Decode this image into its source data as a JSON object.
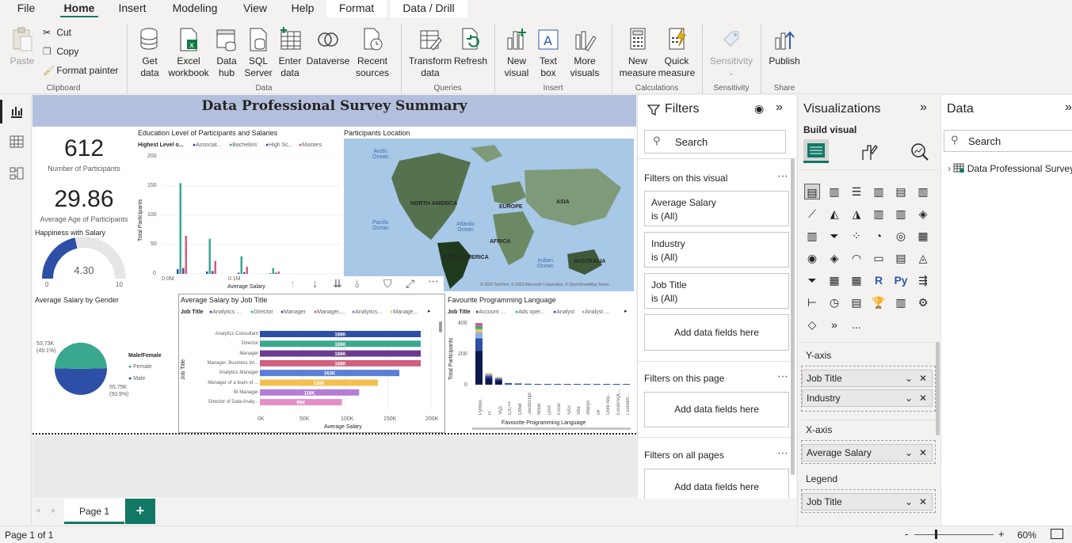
{
  "menu": {
    "tabs": [
      "File",
      "Home",
      "Insert",
      "Modeling",
      "View",
      "Help",
      "Format",
      "Data / Drill"
    ]
  },
  "ribbon": {
    "clipboard": {
      "paste": "Paste",
      "cut": "Cut",
      "copy": "Copy",
      "format_painter": "Format painter",
      "group": "Clipboard"
    },
    "data": {
      "get_data": "Get\ndata",
      "excel": "Excel\nworkbook",
      "datahub": "Data\nhub",
      "sql": "SQL\nServer",
      "enter": "Enter\ndata",
      "dataverse": "Dataverse",
      "recent": "Recent\nsources",
      "group": "Data"
    },
    "queries": {
      "transform": "Transform\ndata",
      "refresh": "Refresh",
      "group": "Queries"
    },
    "insert": {
      "new_visual": "New\nvisual",
      "text_box": "Text\nbox",
      "more": "More\nvisuals",
      "group": "Insert"
    },
    "calculations": {
      "new_measure": "New\nmeasure",
      "quick": "Quick\nmeasure",
      "group": "Calculations"
    },
    "sensitivity": {
      "label": "Sensitivity",
      "group": "Sensitivity"
    },
    "share": {
      "publish": "Publish",
      "group": "Share"
    }
  },
  "report": {
    "title": "Data Professional Survey Summary",
    "kpi1": {
      "value": "612",
      "label": "Number of Participants"
    },
    "kpi2": {
      "value": "29.86",
      "label": "Average Age of Participants"
    },
    "gauge": {
      "title": "Happiness with Salary",
      "value": "4.30",
      "min": "0",
      "max": "10",
      "fraction": 0.43
    },
    "pie": {
      "title": "Average Salary by Gender",
      "legend_title": "Male/Female",
      "female_label": "Female",
      "male_label": "Male",
      "female_value": "53.73K",
      "female_pct": "(49.1%)",
      "male_value": "55.75K",
      "male_pct": "(50.9%)",
      "female_share": 0.491,
      "colors": {
        "female": "#3aa88f",
        "male": "#2e4fa6"
      }
    },
    "edu": {
      "title": "Education Level of Participants and Salaries",
      "legend_title": "Highest Level o...",
      "legend": [
        "Associat...",
        "Bachelors",
        "High Sc...",
        "Masters"
      ],
      "ylabel": "Total Participants",
      "yticks": [
        "200",
        "150",
        "100",
        "50",
        "0"
      ],
      "xticks": [
        "0.0M",
        "0.1M"
      ],
      "xlabel": "Average Salary"
    },
    "map": {
      "title": "Participants Location",
      "labels": {
        "arctic": "Arctic\nOcean",
        "na": "NORTH AMERICA",
        "europe": "EUROPE",
        "asia": "ASIA",
        "pacific": "Pacific\nOcean",
        "atlantic": "Atlantic\nOcean",
        "africa": "AFRICA",
        "sa": "SOUTH AMERICA",
        "indian": "Indian\nOcean",
        "australia": "AUSTRALIA"
      },
      "credits": "© 2023 TomTom, © 2023 Microsoft Corporation, © OpenStreetMap  Terms"
    },
    "jobbar": {
      "title": "Average Salary by Job Title",
      "legend_title": "Job Title",
      "legend": [
        "Analytics ...",
        "Director",
        "Manager",
        "Manager,...",
        "Analytics...",
        "Manage..."
      ],
      "ylabel": "Job Title",
      "xlabel": "Average Salary",
      "xticks": [
        "0K",
        "50K",
        "100K",
        "150K",
        "200K"
      ]
    },
    "lang": {
      "title": "Favourite Programming Language",
      "legend_title": "Job Title",
      "legend": [
        "Account ...",
        "Ads oper...",
        "Analyst",
        "Analyst ..."
      ],
      "ylabel": "Total Participants",
      "xlabel": "Favourite Programming Language",
      "yticks": [
        "400",
        "200",
        "0"
      ],
      "cats": [
        "Python",
        "R",
        "SQL",
        "C/C++",
        "Other",
        "JavaScript",
        "None",
        "DAX",
        "Excel",
        "SAS",
        "Vba",
        "Alteryx",
        "c#",
        "Dont req...",
        "Excel/SQL...",
        "I current..."
      ]
    }
  },
  "chart_data": [
    {
      "type": "bar",
      "title": "Average Salary by Job Title",
      "orientation": "horizontal",
      "categories": [
        "Analytics Consultant",
        "Director",
        "Manager",
        "Manager, Business Int...",
        "Analytics Manager",
        "Manager of a team of ...",
        "BI Manager",
        "Director of Data Analy..."
      ],
      "values": [
        188,
        188,
        188,
        188,
        163,
        138,
        116,
        96
      ],
      "labels": [
        "188K",
        "188K",
        "188K",
        "188K",
        "163K",
        "138K",
        "116K",
        "96K"
      ],
      "colors": [
        "#2e4fa6",
        "#3aa88f",
        "#6b3a8f",
        "#d0607f",
        "#5b7fd6",
        "#f2c14e",
        "#b57ed6",
        "#e48fc5"
      ],
      "xlabel": "Average Salary",
      "ylabel": "Job Title",
      "xlim": [
        0,
        200
      ]
    },
    {
      "type": "bar",
      "title": "Education Level of Participants and Salaries",
      "xlabel": "Average Salary",
      "ylabel": "Total Participants",
      "ylim": [
        0,
        200
      ],
      "series": [
        {
          "name": "Associat...",
          "values": [
            8,
            4,
            2,
            1
          ]
        },
        {
          "name": "Bachelors",
          "values": [
            155,
            60,
            30,
            10
          ]
        },
        {
          "name": "High Sc...",
          "values": [
            10,
            5,
            3,
            2
          ]
        },
        {
          "name": "Masters",
          "values": [
            65,
            22,
            12,
            4
          ]
        }
      ]
    },
    {
      "type": "bar",
      "title": "Favourite Programming Language",
      "xlabel": "Favourite Programming Language",
      "ylabel": "Total Participants",
      "ylim": [
        0,
        400
      ],
      "categories": [
        "Python",
        "R",
        "SQL",
        "C/C++",
        "Other",
        "JavaScript",
        "None",
        "DAX",
        "Excel",
        "SAS",
        "Vba",
        "Alteryx",
        "c#",
        "Dont req...",
        "Excel/SQL...",
        "I current..."
      ],
      "values": [
        420,
        75,
        50,
        10,
        8,
        6,
        5,
        4,
        3,
        2,
        2,
        1,
        1,
        1,
        1,
        1
      ]
    }
  ],
  "filters": {
    "title": "Filters",
    "search": "Search",
    "on_visual": "Filters on this visual",
    "cards": [
      {
        "name": "Average Salary",
        "state": "is (All)"
      },
      {
        "name": "Industry",
        "state": "is (All)"
      },
      {
        "name": "Job Title",
        "state": "is (All)"
      }
    ],
    "add": "Add data fields here",
    "on_page": "Filters on this page",
    "on_all": "Filters on all pages"
  },
  "viz": {
    "title": "Visualizations",
    "build": "Build visual",
    "yaxis": "Y-axis",
    "yfields": [
      "Job Title",
      "Industry"
    ],
    "xaxis": "X-axis",
    "xfields": [
      "Average Salary"
    ],
    "legend": "Legend",
    "lfields": [
      "Job Title"
    ],
    "more": "..."
  },
  "data": {
    "title": "Data",
    "search": "Search",
    "table": "Data Professional Survey"
  },
  "pages": {
    "tab": "Page 1",
    "add": "+"
  },
  "status": {
    "page": "Page 1 of 1",
    "zoom": "60%"
  }
}
